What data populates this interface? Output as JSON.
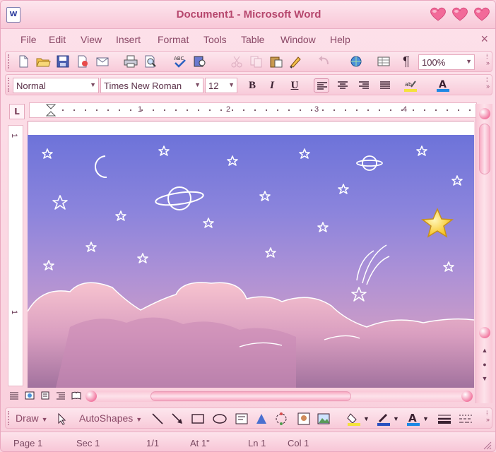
{
  "window": {
    "title": "Document1 - Microsoft Word",
    "app_icon_label": "W",
    "controls": [
      "heart-minimize",
      "heart-maximize",
      "heart-close"
    ]
  },
  "menu": {
    "items": [
      "File",
      "Edit",
      "View",
      "Insert",
      "Format",
      "Tools",
      "Table",
      "Window",
      "Help"
    ],
    "close_glyph": "×"
  },
  "standard_toolbar": {
    "icons": [
      "new-document",
      "open-folder",
      "save",
      "permission",
      "print",
      "print-preview",
      "spelling",
      "research",
      "cut",
      "copy",
      "paste",
      "format-painter",
      "undo",
      "redo",
      "hyperlink",
      "tables-borders",
      "show-hide"
    ],
    "pilcrow": "¶",
    "zoom": "100%"
  },
  "formatting_toolbar": {
    "style": "Normal",
    "font": "Times New Roman",
    "size": "12",
    "bold": "B",
    "italic": "I",
    "underline": "U",
    "active_alignment": "left",
    "highlight_color": "#f4e23a",
    "font_color": "#1e88e5"
  },
  "ruler": {
    "corner_glyph": "L",
    "numbers": [
      "1",
      "2",
      "3",
      "4"
    ],
    "vertical_numbers": [
      "1",
      "1"
    ]
  },
  "drawing_toolbar": {
    "draw_label": "Draw",
    "autoshapes_label": "AutoShapes"
  },
  "status": {
    "page": "Page  1",
    "sec": "Sec  1",
    "pages": "1/1",
    "at": "At  1\"",
    "ln": "Ln  1",
    "col": "Col  1"
  },
  "colors": {
    "accent": "#f27aa2",
    "sky_top": "#6d73d9",
    "sky_bottom": "#c79ac9",
    "star_gold": "#f9d13c"
  }
}
